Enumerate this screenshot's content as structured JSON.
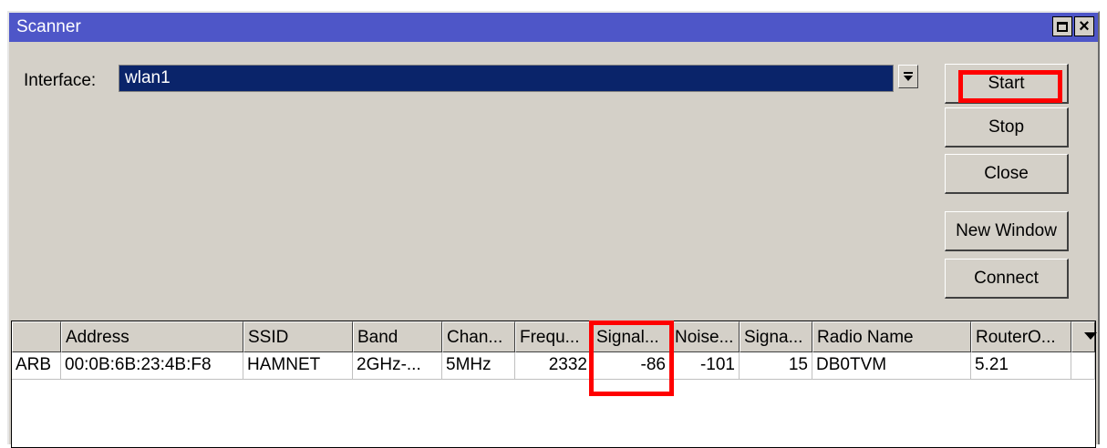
{
  "window": {
    "title": "Scanner"
  },
  "interface": {
    "label": "Interface:",
    "value": "wlan1"
  },
  "buttons": {
    "start": "Start",
    "stop": "Stop",
    "close": "Close",
    "new_window": "New Window",
    "connect": "Connect"
  },
  "table": {
    "columns": [
      "",
      "Address",
      "SSID",
      "Band",
      "Chan...",
      "Frequ...",
      "Signal...",
      "Noise...",
      "Signa...",
      "Radio Name",
      "RouterO..."
    ],
    "rows": [
      [
        "ARB",
        "00:0B:6B:23:4B:F8",
        "HAMNET",
        "2GHz-...",
        "5MHz",
        "2332",
        "-86",
        "-101",
        "15",
        "DB0TVM",
        "5.21"
      ]
    ]
  },
  "icons": {
    "maximize": "maximize-icon",
    "close": "close-icon",
    "dropdown": "dropdown-arrow-icon",
    "column_menu": "column-menu-arrow-icon"
  },
  "colors": {
    "title_bar": "#4e56c8",
    "selection": "#0a246a",
    "highlight": "#ff0000",
    "window_bg": "#d4d0c8"
  }
}
